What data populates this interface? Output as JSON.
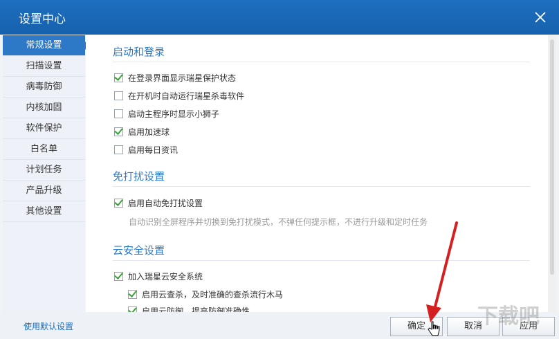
{
  "window": {
    "title": "设置中心",
    "close_icon": "close-icon"
  },
  "sidebar": {
    "items": [
      {
        "label": "常规设置",
        "active": true
      },
      {
        "label": "扫描设置"
      },
      {
        "label": "病毒防御"
      },
      {
        "label": "内核加固"
      },
      {
        "label": "软件保护"
      },
      {
        "label": "白名单"
      },
      {
        "label": "计划任务"
      },
      {
        "label": "产品升级"
      },
      {
        "label": "其他设置"
      }
    ]
  },
  "sections": {
    "startup": {
      "title": "启动和登录",
      "options": [
        {
          "label": "在登录界面显示瑞星保护状态",
          "checked": true
        },
        {
          "label": "在开机时自动运行瑞星杀毒软件",
          "checked": false
        },
        {
          "label": "启动主程序时显示小狮子",
          "checked": false
        },
        {
          "label": "启用加速球",
          "checked": true
        },
        {
          "label": "启用每日资讯",
          "checked": false
        }
      ]
    },
    "dnd": {
      "title": "免打扰设置",
      "options": [
        {
          "label": "启用自动免打扰设置",
          "checked": true
        }
      ],
      "description": "自动识别全屏程序并切换到免打扰模式，不弹任何提示框，不进行升级和定时任务"
    },
    "cloud": {
      "title": "云安全设置",
      "options": [
        {
          "label": "加入瑞星云安全系统",
          "checked": true
        },
        {
          "label": "启用云查杀，及时准确的查杀流行木马",
          "checked": true
        },
        {
          "label": "启用云防御，提高防御准确性",
          "checked": true
        }
      ]
    }
  },
  "footer": {
    "default_link": "使用默认设置",
    "ok": "确定",
    "cancel": "取消",
    "apply": "应用"
  },
  "watermark": "下载吧",
  "colors": {
    "titlebar": "#1d6fbf",
    "accent": "#2e78c8",
    "check": "#3aa23a",
    "arrow": "#d42020"
  }
}
